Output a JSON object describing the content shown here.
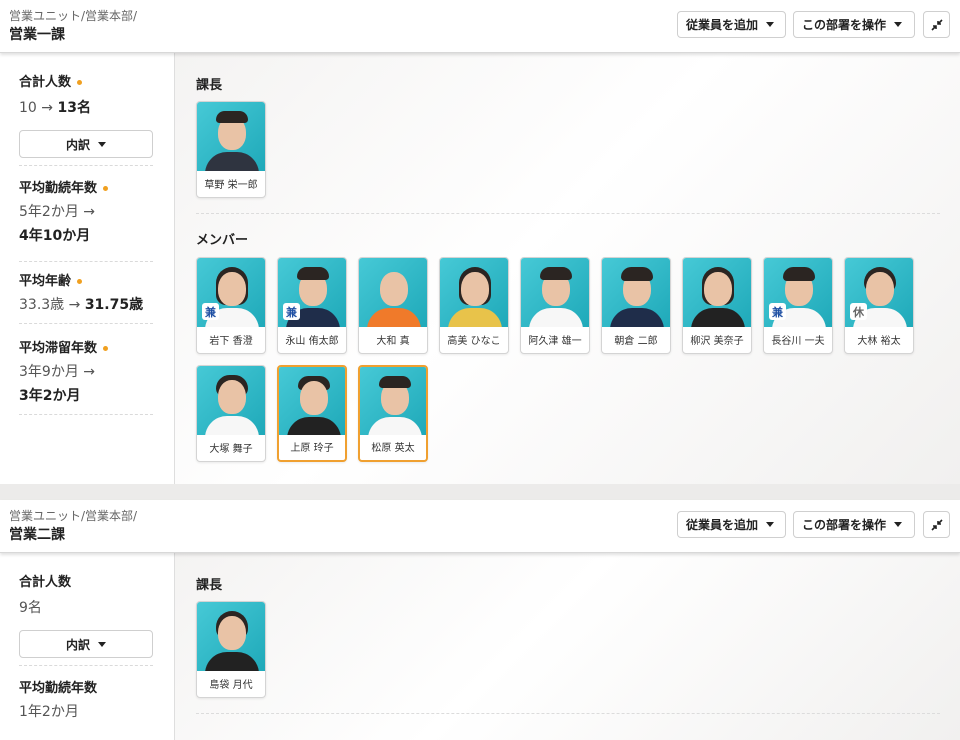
{
  "departments": [
    {
      "breadcrumb": "営業ユニット/営業本部/",
      "name": "営業一課",
      "buttons": {
        "add_employee": "従業員を追加",
        "operate": "この部署を操作"
      },
      "stats": {
        "headcount_label": "合計人数",
        "headcount_from": "10",
        "headcount_to": "13名",
        "breakdown_label": "内訳",
        "tenure_label": "平均勤続年数",
        "tenure_from": "5年2か月",
        "tenure_to": "4年10か月",
        "age_label": "平均年齢",
        "age_from": "33.3歳",
        "age_to": "31.75歳",
        "stay_label": "平均滞留年数",
        "stay_from": "3年9か月",
        "stay_to": "3年2か月"
      },
      "manager_title": "課長",
      "manager": {
        "name": "草野 栄一郎"
      },
      "members_title": "メンバー",
      "members": [
        {
          "name": "岩下 香澄",
          "tag": "兼"
        },
        {
          "name": "永山 侑太郎",
          "tag": "兼"
        },
        {
          "name": "大和 真",
          "tag": ""
        },
        {
          "name": "高美 ひなこ",
          "tag": ""
        },
        {
          "name": "阿久津 雄一",
          "tag": ""
        },
        {
          "name": "朝倉 二郎",
          "tag": ""
        },
        {
          "name": "柳沢 美奈子",
          "tag": ""
        },
        {
          "name": "長谷川 一夫",
          "tag": "兼"
        },
        {
          "name": "大林 裕太",
          "tag": "休"
        },
        {
          "name": "大塚 舞子",
          "tag": ""
        },
        {
          "name": "上原 玲子",
          "tag": ""
        },
        {
          "name": "松原 英太",
          "tag": ""
        }
      ]
    },
    {
      "breadcrumb": "営業ユニット/営業本部/",
      "name": "営業二課",
      "buttons": {
        "add_employee": "従業員を追加",
        "operate": "この部署を操作"
      },
      "stats": {
        "headcount_label": "合計人数",
        "headcount": "9名",
        "breakdown_label": "内訳",
        "tenure_label": "平均勤続年数",
        "tenure_from": "1年2か月"
      },
      "manager_title": "課長",
      "manager": {
        "name": "島袋 月代"
      }
    }
  ],
  "colors": {
    "accent_dot": "#f0a020",
    "highlight_border": "#f0a030",
    "photo_bg": "#2bb5c4",
    "concurrent_tag": "#1e4fa3"
  },
  "icons": {
    "dropdown": "caret-down-icon",
    "collapse": "minimize-icon"
  }
}
